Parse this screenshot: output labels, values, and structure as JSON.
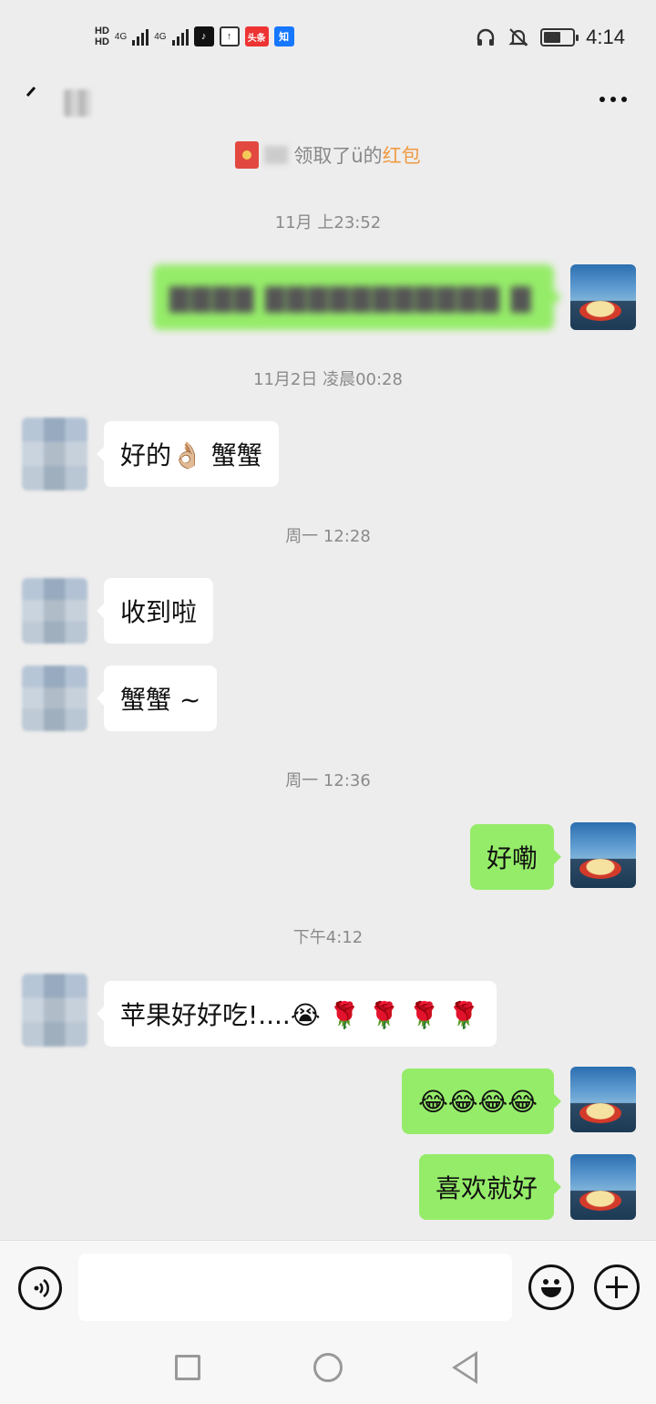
{
  "status_bar": {
    "hd1": "HD",
    "hd2": "HD",
    "net1": "4G",
    "net2": "4G",
    "app_toutiao": "头条",
    "app_zhihu": "知",
    "time": "4:14",
    "battery_level": 0.6
  },
  "header": {
    "back_icon": "back-arrow-icon",
    "more_icon": "more-dots-icon"
  },
  "chat": {
    "redpacket_note": {
      "prefix": "领取了ü的",
      "link": "红包"
    },
    "timestamps": {
      "t1": "11月         上23:52",
      "t2": "11月2日 凌晨00:28",
      "t3": "周一 12:28",
      "t4": "周一 12:36",
      "t5": "下午4:12"
    },
    "messages": {
      "m1_blurred": "▇▇▇▇ ▇▇▇▇▇▇▇▇▇▇▇ ▇",
      "m2": "好的👌🏼 蟹蟹",
      "m3": "收到啦",
      "m4": "蟹蟹 ~",
      "m5": "好嘞",
      "m6": "苹果好好吃!....😭 🌹 🌹 🌹 🌹",
      "m7": "😂😂😂😂",
      "m8": "喜欢就好"
    }
  },
  "input_bar": {
    "placeholder": "",
    "voice_icon": "voice-icon",
    "emoji_icon": "emoji-icon",
    "plus_icon": "plus-icon"
  },
  "colors": {
    "bg": "#ededed",
    "bubble_me": "#95ec69",
    "bubble_them": "#ffffff",
    "redpacket_link": "#f09a42"
  }
}
